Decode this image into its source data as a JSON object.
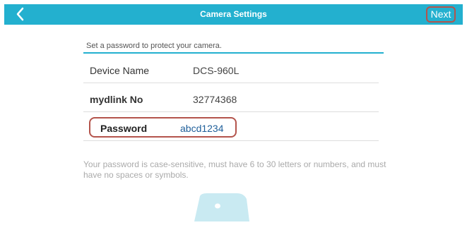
{
  "header": {
    "title": "Camera Settings",
    "next_label": "Next",
    "back_icon": "chevron-left-icon",
    "color": "#23b0cf"
  },
  "form": {
    "subtitle": "Set a password to protect your camera.",
    "rows": [
      {
        "label": "Device Name",
        "value": "DCS-960L"
      },
      {
        "label": "mydlink No",
        "value": "32774368"
      }
    ],
    "password": {
      "label": "Password",
      "value": "abcd1234"
    },
    "hint": "Your password is case-sensitive, must have 6 to 30 letters or numbers, and must have no spaces or symbols."
  },
  "colors": {
    "accent": "#23b0cf",
    "highlight_border": "#b4544c",
    "password_value": "#1f5f9a"
  },
  "illustration": {
    "icon": "camera-illustration-icon"
  }
}
